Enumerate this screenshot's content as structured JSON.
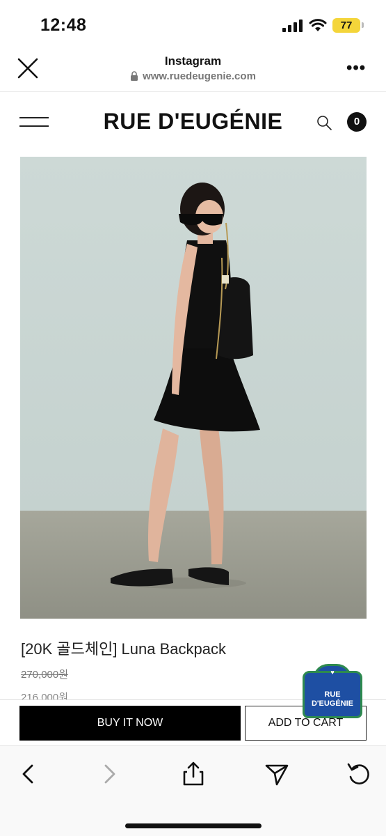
{
  "status_bar": {
    "time": "12:48",
    "battery": "77"
  },
  "browser": {
    "title": "Instagram",
    "url": "www.ruedeugenie.com"
  },
  "site": {
    "brand": "RUE D'EUGÉNIE",
    "cart_count": "0"
  },
  "product": {
    "name": "[20K 골드체인] Luna Backpack",
    "price_original": "270,000원",
    "price_sale": "216,000원"
  },
  "badge": {
    "line1": "RUE",
    "line2": "D'EUGÉNIE",
    "symbol": "♥"
  },
  "actions": {
    "buy_now": "BUY IT NOW",
    "add_to_cart": "ADD TO CART"
  },
  "toolbar_icons": [
    "back-icon",
    "forward-icon",
    "share-icon",
    "send-icon",
    "reload-icon"
  ],
  "colors": {
    "badge_blue": "#1e4fa3",
    "badge_green": "#2e8a4f",
    "battery_yellow": "#f4d53a"
  }
}
